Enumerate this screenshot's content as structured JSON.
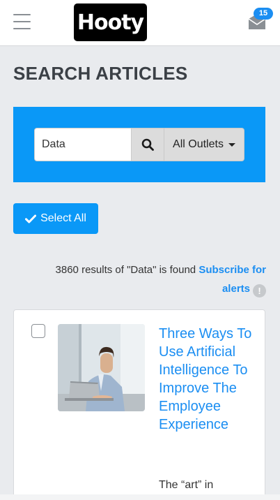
{
  "header": {
    "menu_icon": "hamburger-menu-icon",
    "logo_text": "Hooty",
    "mail_icon": "envelope-icon",
    "notification_count": "15"
  },
  "page": {
    "title": "SEARCH ARTICLES"
  },
  "search": {
    "query": "Data",
    "button_icon": "search-icon",
    "outlet_selected": "All Outlets"
  },
  "actions": {
    "select_all_label": "Select All",
    "select_all_icon": "checkmark-icon"
  },
  "results": {
    "summary": "3860 results of \"Data\" is found",
    "subscribe_label": "Subscribe for alerts",
    "info_icon": "info-icon"
  },
  "articles": [
    {
      "title": "Three Ways To Use Artificial Intelligence To Improve The Employee Experience",
      "excerpt": "The “art” in",
      "checked": false
    }
  ],
  "colors": {
    "accent": "#0a98f7",
    "link": "#1b8ef2",
    "background": "#e9ebee"
  }
}
